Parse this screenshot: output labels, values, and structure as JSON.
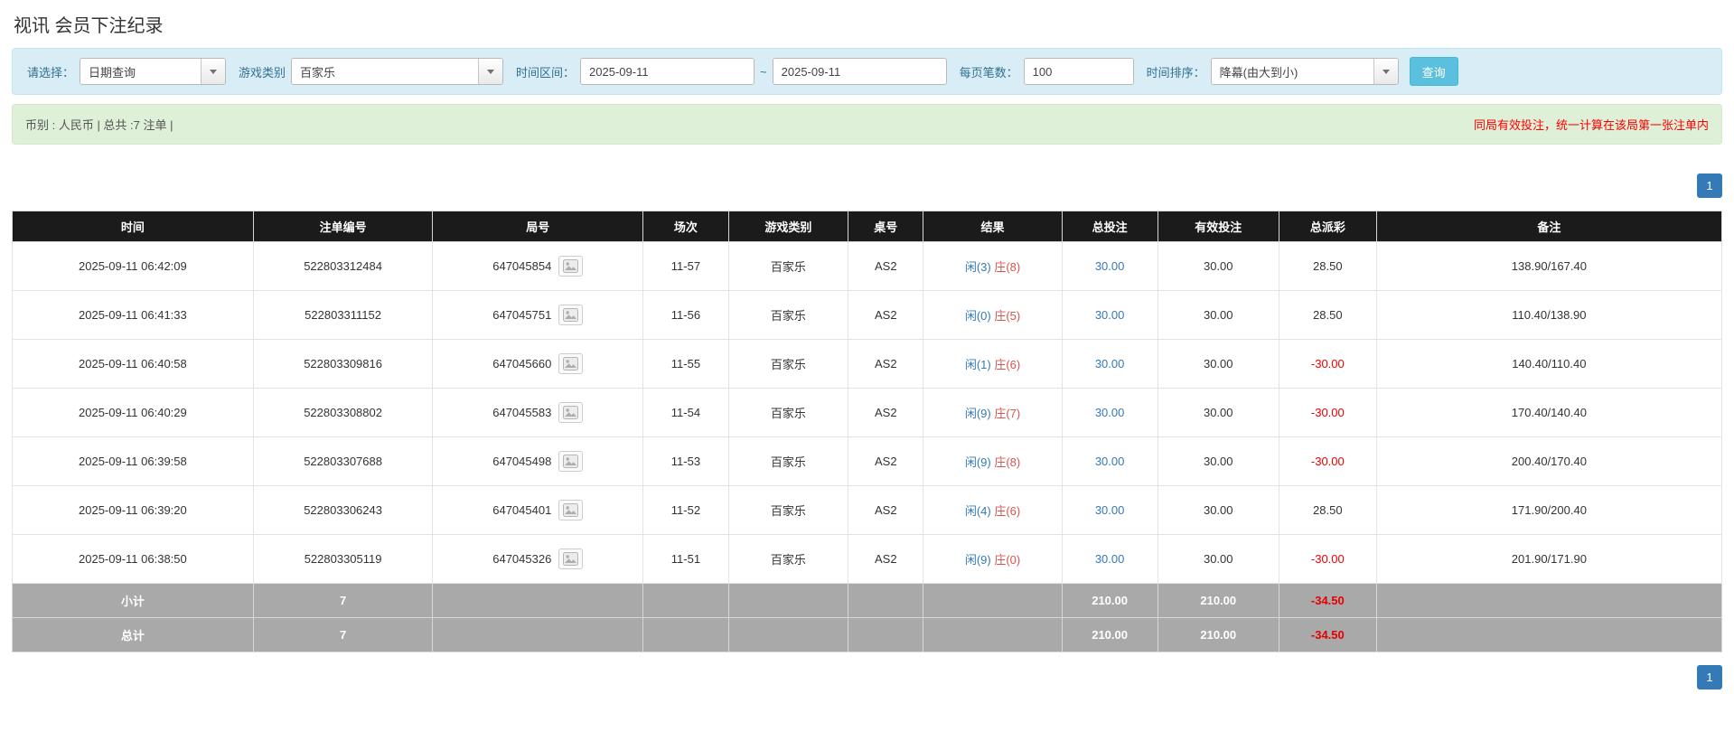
{
  "page": {
    "title": "视讯 会员下注纪录"
  },
  "filters": {
    "select_label": "请选择：",
    "select_value": "日期查询",
    "game_type_label": "游戏类别",
    "game_type_value": "百家乐",
    "date_range_label": "时间区间：",
    "date_from": "2025-09-11",
    "date_separator": "~",
    "date_to": "2025-09-11",
    "page_size_label": "每页笔数：",
    "page_size_value": "100",
    "sort_label": "时间排序：",
    "sort_value": "降幕(由大到小)",
    "search_button": "查询"
  },
  "summary": {
    "left": "币别 : 人民币 | 总共 :7 注单 |",
    "right": "同局有效投注，统一计算在该局第一张注单内"
  },
  "pagination": {
    "page": "1"
  },
  "table": {
    "headers": [
      "时间",
      "注单编号",
      "局号",
      "场次",
      "游戏类别",
      "桌号",
      "结果",
      "总投注",
      "有效投注",
      "总派彩",
      "备注"
    ],
    "rows": [
      {
        "time": "2025-09-11 06:42:09",
        "bet_id": "522803312484",
        "round": "647045854",
        "session": "11-57",
        "game": "百家乐",
        "table": "AS2",
        "result_player": "闲(3)",
        "result_banker": "庄(8)",
        "total_bet": "30.00",
        "valid_bet": "30.00",
        "payout": "28.50",
        "note": "138.90/167.40"
      },
      {
        "time": "2025-09-11 06:41:33",
        "bet_id": "522803311152",
        "round": "647045751",
        "session": "11-56",
        "game": "百家乐",
        "table": "AS2",
        "result_player": "闲(0)",
        "result_banker": "庄(5)",
        "total_bet": "30.00",
        "valid_bet": "30.00",
        "payout": "28.50",
        "note": "110.40/138.90"
      },
      {
        "time": "2025-09-11 06:40:58",
        "bet_id": "522803309816",
        "round": "647045660",
        "session": "11-55",
        "game": "百家乐",
        "table": "AS2",
        "result_player": "闲(1)",
        "result_banker": "庄(6)",
        "total_bet": "30.00",
        "valid_bet": "30.00",
        "payout": "-30.00",
        "note": "140.40/110.40"
      },
      {
        "time": "2025-09-11 06:40:29",
        "bet_id": "522803308802",
        "round": "647045583",
        "session": "11-54",
        "game": "百家乐",
        "table": "AS2",
        "result_player": "闲(9)",
        "result_banker": "庄(7)",
        "total_bet": "30.00",
        "valid_bet": "30.00",
        "payout": "-30.00",
        "note": "170.40/140.40"
      },
      {
        "time": "2025-09-11 06:39:58",
        "bet_id": "522803307688",
        "round": "647045498",
        "session": "11-53",
        "game": "百家乐",
        "table": "AS2",
        "result_player": "闲(9)",
        "result_banker": "庄(8)",
        "total_bet": "30.00",
        "valid_bet": "30.00",
        "payout": "-30.00",
        "note": "200.40/170.40"
      },
      {
        "time": "2025-09-11 06:39:20",
        "bet_id": "522803306243",
        "round": "647045401",
        "session": "11-52",
        "game": "百家乐",
        "table": "AS2",
        "result_player": "闲(4)",
        "result_banker": "庄(6)",
        "total_bet": "30.00",
        "valid_bet": "30.00",
        "payout": "28.50",
        "note": "171.90/200.40"
      },
      {
        "time": "2025-09-11 06:38:50",
        "bet_id": "522803305119",
        "round": "647045326",
        "session": "11-51",
        "game": "百家乐",
        "table": "AS2",
        "result_player": "闲(9)",
        "result_banker": "庄(0)",
        "total_bet": "30.00",
        "valid_bet": "30.00",
        "payout": "-30.00",
        "note": "201.90/171.90"
      }
    ],
    "subtotal": {
      "label": "小计",
      "count": "7",
      "total_bet": "210.00",
      "valid_bet": "210.00",
      "payout": "-34.50"
    },
    "total": {
      "label": "总计",
      "count": "7",
      "total_bet": "210.00",
      "valid_bet": "210.00",
      "payout": "-34.50"
    }
  }
}
